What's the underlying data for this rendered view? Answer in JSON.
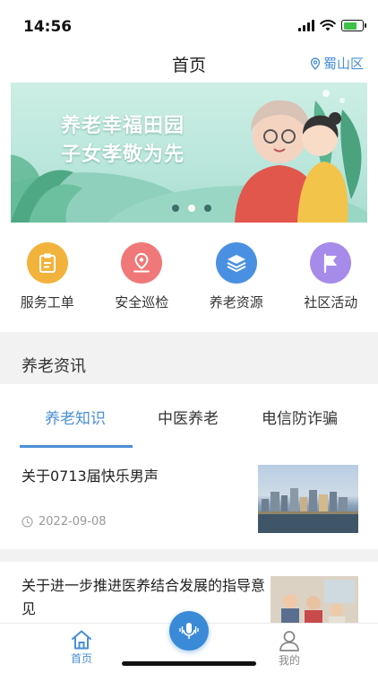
{
  "status_bar": {
    "time": "14:56"
  },
  "header": {
    "title": "首页",
    "location": "蜀山区"
  },
  "banner": {
    "line1": "养老幸福田园",
    "line2": "子女孝敬为先",
    "active_slide_index": 1,
    "slide_count": 3
  },
  "quick_entries": [
    {
      "label": "服务工单",
      "icon": "clipboard-icon",
      "color": "#f2b33d"
    },
    {
      "label": "安全巡检",
      "icon": "location-pin-icon",
      "color": "#f07878"
    },
    {
      "label": "养老资源",
      "icon": "layers-icon",
      "color": "#4a90e2"
    },
    {
      "label": "社区活动",
      "icon": "flag-icon",
      "color": "#a78bea"
    }
  ],
  "section": {
    "title": "养老资讯"
  },
  "tabs": [
    {
      "label": "养老知识",
      "active": true
    },
    {
      "label": "中医养老",
      "active": false
    },
    {
      "label": "电信防诈骗",
      "active": false
    }
  ],
  "articles": [
    {
      "title": "关于0713届快乐男声",
      "date": "2022-09-08"
    },
    {
      "title": "关于进一步推进医养结合发展的指导意见"
    }
  ],
  "bottom_nav": {
    "home": "首页",
    "me": "我的"
  },
  "colors": {
    "accent": "#4a8fd6"
  }
}
